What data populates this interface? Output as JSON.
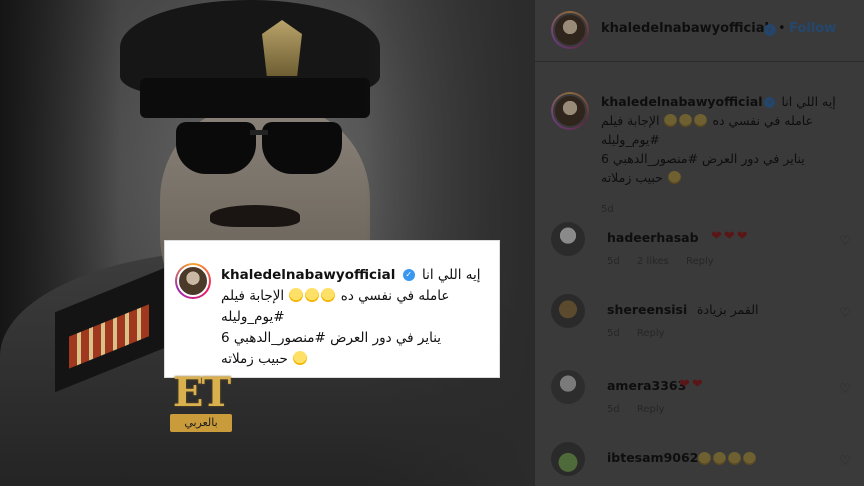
{
  "post": {
    "username": "khaledelnabawyofficial",
    "verified_icon": "verified-badge-icon",
    "follow_separator": "•",
    "follow_label": "Follow",
    "caption_lines": [
      "إيه اللي انا",
      "عامله في نفسي ده",
      "الإجابة فيلم",
      "#يوم_وليله",
      "يناير في دور العرض #منصور_الدهبي 6",
      "حبيب زملاته"
    ],
    "caption_time": "5d"
  },
  "overlay_card": {
    "username": "khaledelnabawyofficial",
    "line1": "إيه اللي انا",
    "line2": "عامله في نفسي ده",
    "line2b": "الإجابة فيلم",
    "line3": "#يوم_وليله",
    "line4": "يناير في دور العرض #منصور_الدهبي 6",
    "line5": "حبيب زملاته"
  },
  "logo": {
    "letters": "ET",
    "subtitle": "بالعربي"
  },
  "comments": [
    {
      "username": "hadeerhasab",
      "text": "❤❤❤",
      "time": "5d",
      "likes": "2 likes",
      "reply": "Reply"
    },
    {
      "username": "shereensisi",
      "text": "القمر بزيادة",
      "time": "5d",
      "likes": "",
      "reply": "Reply"
    },
    {
      "username": "amera3363",
      "text": "❤❤",
      "time": "5d",
      "likes": "",
      "reply": "Reply"
    },
    {
      "username": "ibtesam9062",
      "text": "",
      "time": "",
      "likes": "",
      "reply": ""
    }
  ],
  "colors": {
    "panel_bg": "#3a3a3a",
    "card_bg": "#ffffff",
    "accent_blue": "#3897f0",
    "logo_gold": "#d9b04e"
  }
}
